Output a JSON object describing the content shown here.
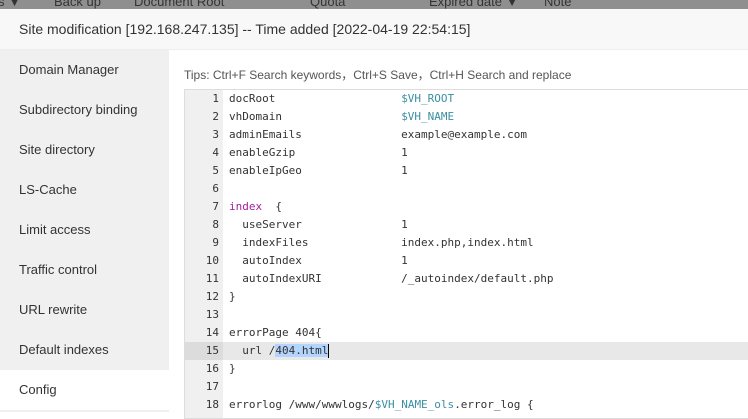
{
  "background_table_headers": [
    {
      "label": "s ▼"
    },
    {
      "label": "Back up"
    },
    {
      "label": "Document Root"
    },
    {
      "label": "Quota"
    },
    {
      "label": "Expired date ▼"
    },
    {
      "label": "Note"
    }
  ],
  "title": "Site modification [192.168.247.135] -- Time added [2022-04-19 22:54:15]",
  "sidebar": {
    "items": [
      {
        "label": "Domain Manager"
      },
      {
        "label": "Subdirectory binding"
      },
      {
        "label": "Site directory"
      },
      {
        "label": "LS-Cache"
      },
      {
        "label": "Limit access"
      },
      {
        "label": "Traffic control"
      },
      {
        "label": "URL rewrite"
      },
      {
        "label": "Default indexes"
      },
      {
        "label": "Config",
        "active": true
      }
    ]
  },
  "tips": "Tips: Ctrl+F Search keywords，Ctrl+S Save，Ctrl+H Search and replace",
  "editor": {
    "active_line": 15,
    "lines": [
      [
        {
          "t": "docRoot                   "
        },
        {
          "t": "$VH_ROOT",
          "c": "var"
        }
      ],
      [
        {
          "t": "vhDomain                  "
        },
        {
          "t": "$VH_NAME",
          "c": "var"
        }
      ],
      [
        {
          "t": "adminEmails               example@example.com"
        }
      ],
      [
        {
          "t": "enableGzip                1"
        }
      ],
      [
        {
          "t": "enableIpGeo               1"
        }
      ],
      [],
      [
        {
          "t": "index",
          "c": "kw"
        },
        {
          "t": "  {"
        }
      ],
      [
        {
          "t": "  useServer               1"
        }
      ],
      [
        {
          "t": "  indexFiles              index.php,index.html"
        }
      ],
      [
        {
          "t": "  autoIndex               1"
        }
      ],
      [
        {
          "t": "  autoIndexURI            /_autoindex/default.php"
        }
      ],
      [
        {
          "t": "}"
        }
      ],
      [],
      [
        {
          "t": "errorPage 404{"
        }
      ],
      [
        {
          "t": "  url /"
        },
        {
          "t": "404.html",
          "c": "sel"
        }
      ],
      [
        {
          "t": "}"
        }
      ],
      [],
      [
        {
          "t": "errorlog /www/wwwlogs/"
        },
        {
          "t": "$VH_NAME_ols",
          "c": "var"
        },
        {
          "t": ".error_log {"
        }
      ]
    ]
  }
}
